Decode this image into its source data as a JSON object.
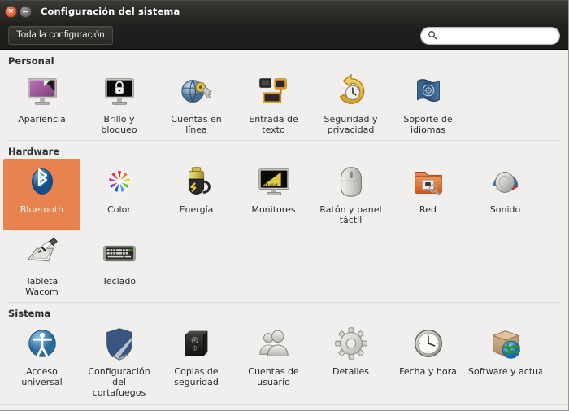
{
  "window": {
    "title": "Configuración del sistema",
    "close_icon": "close-icon",
    "minimize_icon": "minimize-icon",
    "close_glyph": "×",
    "minimize_glyph": "−",
    "accent_selected": "#e8834f",
    "background": "#f0efee",
    "titlebar_bg": "#2e2d2a"
  },
  "toolbar": {
    "all_settings_label": "Toda la configuración",
    "search_icon": "search-icon",
    "search_value": "",
    "search_placeholder": ""
  },
  "sections": [
    {
      "title": "Personal",
      "items": [
        {
          "label": "Apariencia",
          "icon": "appearance-icon"
        },
        {
          "label": "Brillo y\nbloqueo",
          "icon": "brightness-lock-icon"
        },
        {
          "label": "Cuentas en\nlínea",
          "icon": "online-accounts-icon"
        },
        {
          "label": "Entrada de\ntexto",
          "icon": "text-entry-icon"
        },
        {
          "label": "Seguridad y\nprivacidad",
          "icon": "security-privacy-icon"
        },
        {
          "label": "Soporte de\nidiomas",
          "icon": "language-support-icon"
        }
      ]
    },
    {
      "title": "Hardware",
      "items": [
        {
          "label": "Bluetooth",
          "icon": "bluetooth-icon",
          "selected": true
        },
        {
          "label": "Color",
          "icon": "color-icon"
        },
        {
          "label": "Energía",
          "icon": "power-icon"
        },
        {
          "label": "Monitores",
          "icon": "displays-icon"
        },
        {
          "label": "Ratón y panel\ntáctil",
          "icon": "mouse-touchpad-icon"
        },
        {
          "label": "Red",
          "icon": "network-icon"
        },
        {
          "label": "Sonido",
          "icon": "sound-icon"
        },
        {
          "label": "Tableta\nWacom",
          "icon": "wacom-tablet-icon"
        },
        {
          "label": "Teclado",
          "icon": "keyboard-icon"
        }
      ]
    },
    {
      "title": "Sistema",
      "items": [
        {
          "label": "Acceso\nuniversal",
          "icon": "universal-access-icon"
        },
        {
          "label": "Configuración\ndel\ncortafuegos",
          "icon": "firewall-config-icon"
        },
        {
          "label": "Copias de\nseguridad",
          "icon": "backups-icon"
        },
        {
          "label": "Cuentas de\nusuario",
          "icon": "user-accounts-icon"
        },
        {
          "label": "Detalles",
          "icon": "details-icon"
        },
        {
          "label": "Fecha y hora",
          "icon": "date-time-icon"
        },
        {
          "label": "Software y\nactualizaciones",
          "icon": "software-updates-icon",
          "clipped": true
        }
      ]
    }
  ]
}
